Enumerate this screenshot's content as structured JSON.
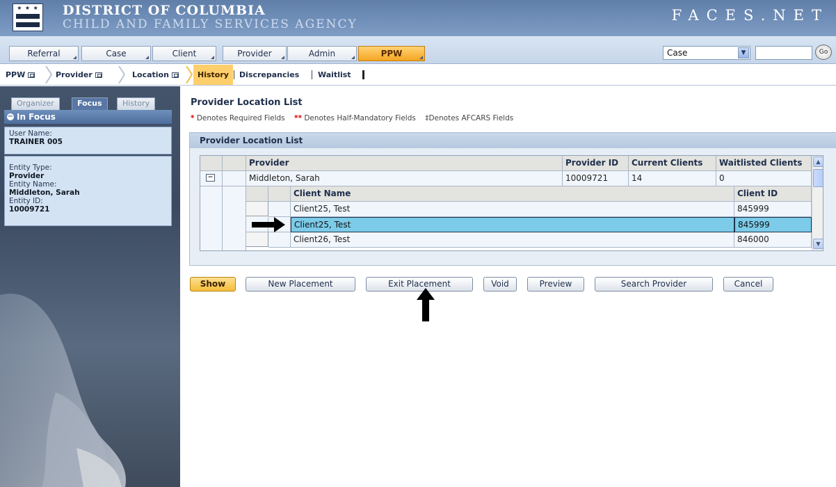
{
  "banner": {
    "title": "DISTRICT OF COLUMBIA",
    "subtitle": "CHILD AND FAMILY SERVICES AGENCY",
    "logo_text": "FACES.NET"
  },
  "topnav": {
    "tabs": [
      {
        "label": "Referral"
      },
      {
        "label": "Case"
      },
      {
        "label": "Client"
      },
      {
        "label": "Provider"
      },
      {
        "label": "Admin"
      },
      {
        "label": "PPW"
      }
    ],
    "search_select_value": "Case",
    "search_input_value": "",
    "go_label": "Go"
  },
  "breadcrumb": {
    "items": [
      "PPW",
      "Provider",
      "Location",
      "History",
      "Discrepancies",
      "Waitlist"
    ]
  },
  "left_panel": {
    "tabs": [
      "Organizer",
      "Focus",
      "History"
    ],
    "in_focus_title": "In Focus",
    "user_name_label": "User Name:",
    "user_name_value": "TRAINER 005",
    "entity_type_label": "Entity Type:",
    "entity_type_value": "Provider",
    "entity_name_label": "Entity Name:",
    "entity_name_value": "Middleton, Sarah",
    "entity_id_label": "Entity ID:",
    "entity_id_value": "10009721"
  },
  "main": {
    "page_title": "Provider Location List",
    "legend": {
      "required_mark": "*",
      "required_text": "Denotes Required Fields",
      "half_mark": "**",
      "half_text": "Denotes Half-Mandatory Fields",
      "afcars_text": "‡Denotes AFCARS Fields"
    },
    "panel_title": "Provider Location List",
    "grid": {
      "headers": [
        "Provider",
        "Provider ID",
        "Current Clients",
        "Waitlisted Clients"
      ],
      "provider_row": {
        "toggle": "−",
        "provider": "Middleton, Sarah",
        "provider_id": "10009721",
        "current_clients": "14",
        "waitlisted_clients": "0"
      },
      "sub_headers": [
        "Client Name",
        "Client ID"
      ],
      "client_rows": [
        {
          "name": "Client25, Test",
          "id": "845999",
          "selected": false
        },
        {
          "name": "Client25, Test",
          "id": "845999",
          "selected": true
        },
        {
          "name": "Client26, Test",
          "id": "846000",
          "selected": false
        }
      ]
    },
    "buttons": {
      "show": "Show",
      "new_placement": "New Placement",
      "exit_placement": "Exit Placement",
      "void": "Void",
      "preview": "Preview",
      "search_provider": "Search Provider",
      "cancel": "Cancel"
    }
  },
  "colors": {
    "banner_blue": "#6d8cb6",
    "active_tab_orange": "#f5a623",
    "selected_row_cyan": "#7ccbe8",
    "sidebar_slate": "#44546b"
  }
}
